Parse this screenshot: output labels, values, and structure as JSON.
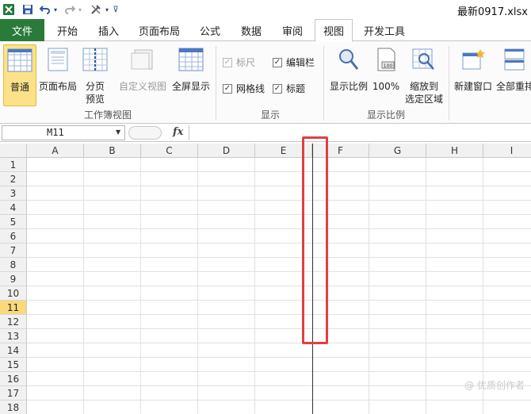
{
  "title_bar": {
    "filename": "最新0917.xlsx"
  },
  "tabs": {
    "file": "文件",
    "items": [
      "开始",
      "插入",
      "页面布局",
      "公式",
      "数据",
      "审阅",
      "视图",
      "开发工具"
    ],
    "active": "视图"
  },
  "ribbon": {
    "workbook_views": {
      "label": "工作簿视图",
      "normal": "普通",
      "page_layout": "页面布局",
      "page_break_1": "分页",
      "page_break_2": "预览",
      "custom_views": "自定义视图",
      "full_screen": "全屏显示"
    },
    "show": {
      "label": "显示",
      "ruler": "标尺",
      "formula_bar": "编辑栏",
      "gridlines": "网格线",
      "headings": "标题"
    },
    "zoom": {
      "label": "显示比例",
      "zoom": "显示比例",
      "hundred": "100%",
      "zoom_sel_1": "缩放到",
      "zoom_sel_2": "选定区域"
    },
    "window": {
      "new_window": "新建窗口",
      "arrange_all": "全部重排"
    }
  },
  "formula_bar": {
    "name_box": "M11",
    "fx": "fx"
  },
  "grid": {
    "columns": [
      "A",
      "B",
      "C",
      "D",
      "E",
      "F",
      "G",
      "H",
      "I"
    ],
    "rows": [
      "1",
      "2",
      "3",
      "4",
      "5",
      "6",
      "7",
      "8",
      "9",
      "10",
      "11",
      "12",
      "13",
      "14",
      "15",
      "16",
      "17",
      "18"
    ],
    "selected_row": "11"
  },
  "watermark": "@ 优质创作者"
}
